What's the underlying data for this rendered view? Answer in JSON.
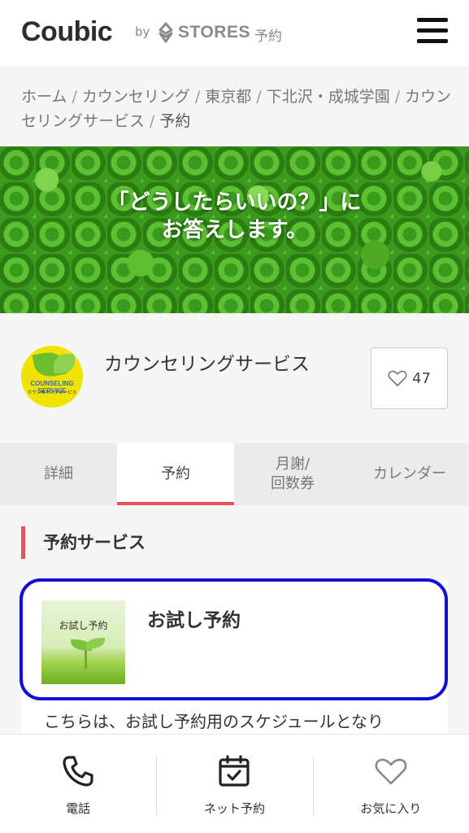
{
  "header": {
    "logo": "Coubic",
    "by": "by",
    "stores": "STORES",
    "stores_suffix": "予約"
  },
  "breadcrumb": {
    "items": [
      "ホーム",
      "カウンセリング",
      "東京都",
      "下北沢・成城学園",
      "カウンセリングサービス"
    ],
    "current": "予約",
    "separator": "/"
  },
  "hero": {
    "line1": "「どうしたらいいの？」に",
    "line2": "お答えします。"
  },
  "shop": {
    "logo_text_en": "COUNSELING SERVICE",
    "logo_text_ja": "カウンセリングサービス",
    "name": "カウンセリングサービス",
    "favorite_count": "47"
  },
  "tabs": [
    {
      "label": "詳細",
      "active": false
    },
    {
      "label": "予約",
      "active": true
    },
    {
      "label": "月謝/\n回数券",
      "active": false
    },
    {
      "label": "カレンダー",
      "active": false
    }
  ],
  "section": {
    "title": "予約サービス"
  },
  "service_card": {
    "thumb_text": "お試し予約",
    "title": "お試し予約",
    "description": "こちらは、お試し予約用のスケジュールとなり"
  },
  "bottom_nav": {
    "phone_label": "電話",
    "booking_label": "ネット予約",
    "favorite_label": "お気に入り"
  },
  "colors": {
    "accent": "#e8505b",
    "highlight": "#1010d8",
    "brand_yellow": "#f2e200"
  }
}
